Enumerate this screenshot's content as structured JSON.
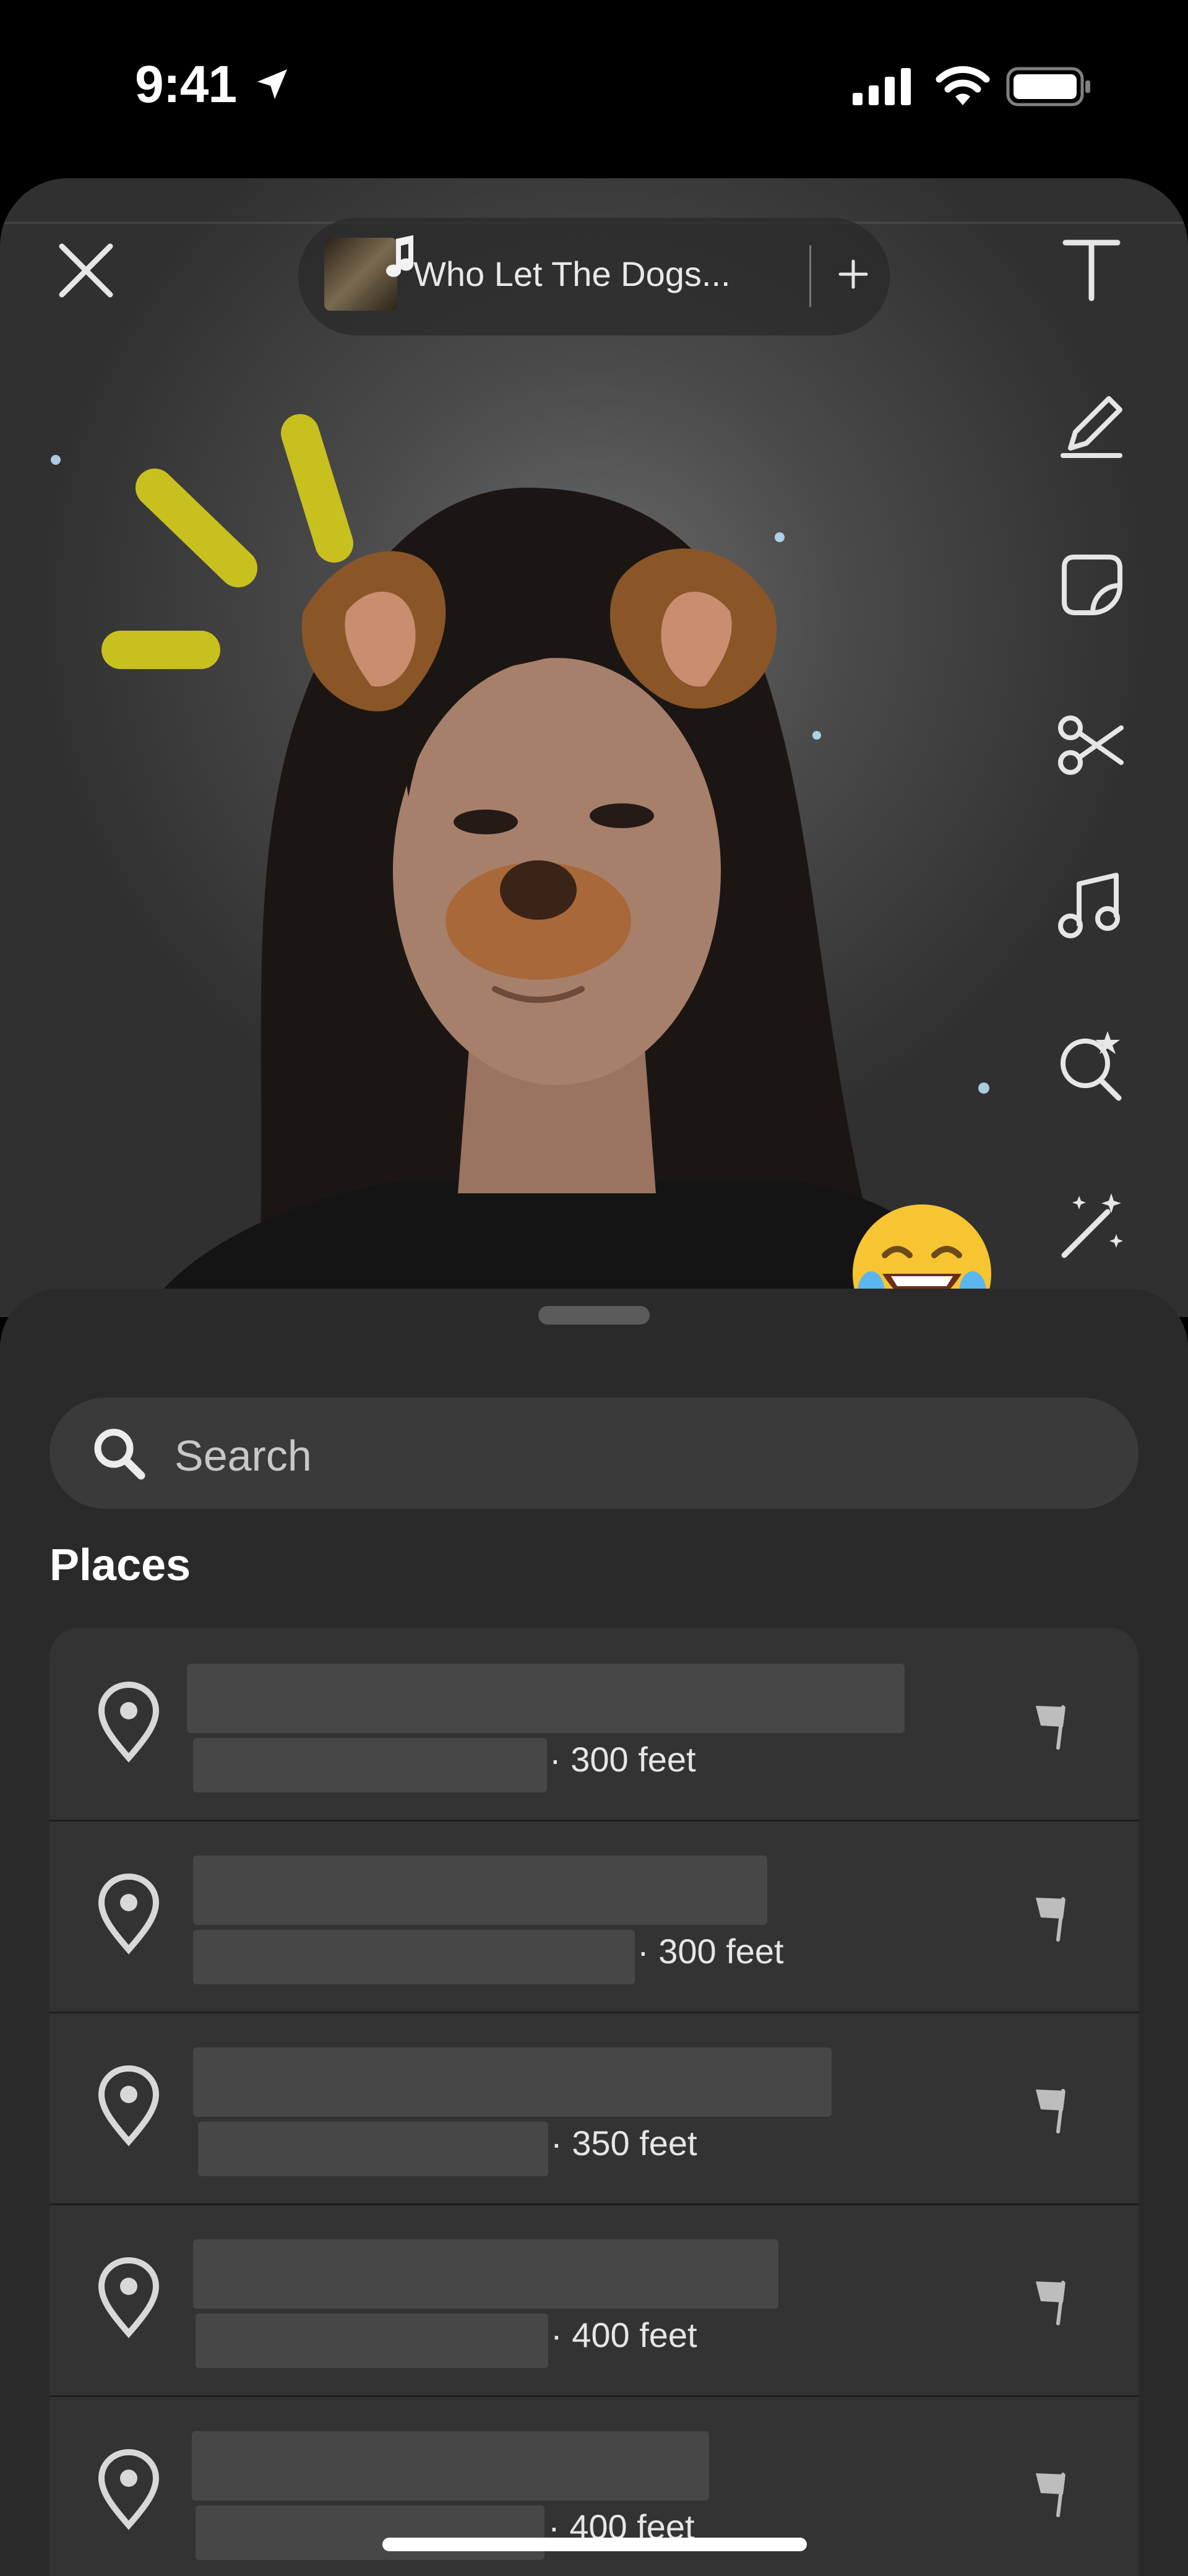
{
  "status_bar": {
    "time": "9:41"
  },
  "music": {
    "song_title": "Who Let The Dogs..."
  },
  "tools": [
    "text-tool",
    "draw-tool",
    "sticker-tool",
    "scissors-tool",
    "music-tool",
    "lens-search-tool",
    "magic-tool"
  ],
  "search": {
    "placeholder": "Search"
  },
  "places": {
    "title": "Places",
    "items": [
      {
        "distance": "· 300 feet"
      },
      {
        "distance": "· 300 feet"
      },
      {
        "distance": "· 350 feet"
      },
      {
        "distance": "· 400 feet"
      },
      {
        "distance": "· 400 feet"
      }
    ]
  },
  "colors": {
    "accent_yellow": "#C8C01E",
    "sheet_bg": "#2A2A2A",
    "list_bg": "#333333"
  }
}
